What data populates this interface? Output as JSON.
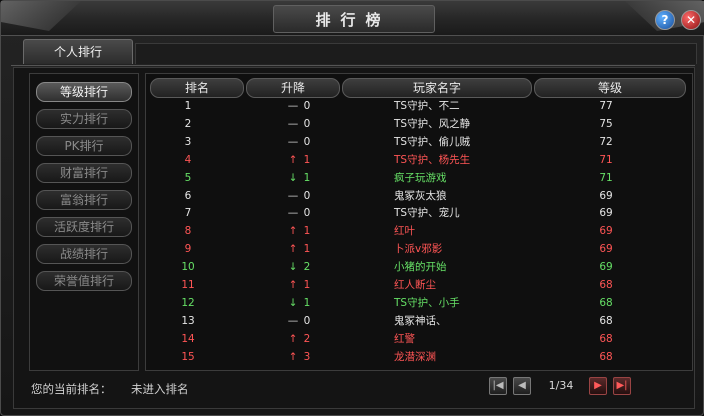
{
  "window": {
    "title": "排行榜",
    "help_label": "?",
    "close_label": "✕"
  },
  "tabs": [
    {
      "label": "个人排行"
    }
  ],
  "sidebar": {
    "items": [
      {
        "label": "等级排行",
        "active": true
      },
      {
        "label": "实力排行",
        "active": false
      },
      {
        "label": "PK排行",
        "active": false
      },
      {
        "label": "财富排行",
        "active": false
      },
      {
        "label": "富翁排行",
        "active": false
      },
      {
        "label": "活跃度排行",
        "active": false
      },
      {
        "label": "战绩排行",
        "active": false
      },
      {
        "label": "荣誉值排行",
        "active": false
      }
    ]
  },
  "table": {
    "headers": {
      "rank": "排名",
      "change": "升降",
      "name": "玩家名字",
      "level": "等级"
    },
    "colors": {
      "same": "#e6e6e6",
      "up": "#ff5555",
      "down": "#66e066"
    },
    "rows": [
      {
        "rank": "1",
        "trend": "same",
        "delta": "0",
        "name": "TS守护、不二",
        "level": "77"
      },
      {
        "rank": "2",
        "trend": "same",
        "delta": "0",
        "name": "TS守护、风之静",
        "level": "75"
      },
      {
        "rank": "3",
        "trend": "same",
        "delta": "0",
        "name": "TS守护、偷儿贼",
        "level": "72"
      },
      {
        "rank": "4",
        "trend": "up",
        "delta": "1",
        "name": "TS守护、杨先生",
        "level": "71"
      },
      {
        "rank": "5",
        "trend": "down",
        "delta": "1",
        "name": "疯子玩游戏",
        "level": "71"
      },
      {
        "rank": "6",
        "trend": "same",
        "delta": "0",
        "name": "鬼冢灰太狼",
        "level": "69"
      },
      {
        "rank": "7",
        "trend": "same",
        "delta": "0",
        "name": "TS守护、宠儿",
        "level": "69"
      },
      {
        "rank": "8",
        "trend": "up",
        "delta": "1",
        "name": "红叶",
        "level": "69"
      },
      {
        "rank": "9",
        "trend": "up",
        "delta": "1",
        "name": "卜派v邪影",
        "level": "69"
      },
      {
        "rank": "10",
        "trend": "down",
        "delta": "2",
        "name": "小猪的开始",
        "level": "69"
      },
      {
        "rank": "11",
        "trend": "up",
        "delta": "1",
        "name": "红人断尘",
        "level": "68"
      },
      {
        "rank": "12",
        "trend": "down",
        "delta": "1",
        "name": "TS守护、小手",
        "level": "68"
      },
      {
        "rank": "13",
        "trend": "same",
        "delta": "0",
        "name": "鬼冢神话、",
        "level": "68"
      },
      {
        "rank": "14",
        "trend": "up",
        "delta": "2",
        "name": "红警",
        "level": "68"
      },
      {
        "rank": "15",
        "trend": "up",
        "delta": "3",
        "name": "龙潜深渊",
        "level": "68"
      }
    ]
  },
  "footer": {
    "current_rank_label": "您的当前排名：",
    "current_rank_value": "未进入排名",
    "page": "1/34",
    "buttons": {
      "first": "|◀",
      "prev": "◀",
      "next": "▶",
      "last": "▶|"
    }
  }
}
